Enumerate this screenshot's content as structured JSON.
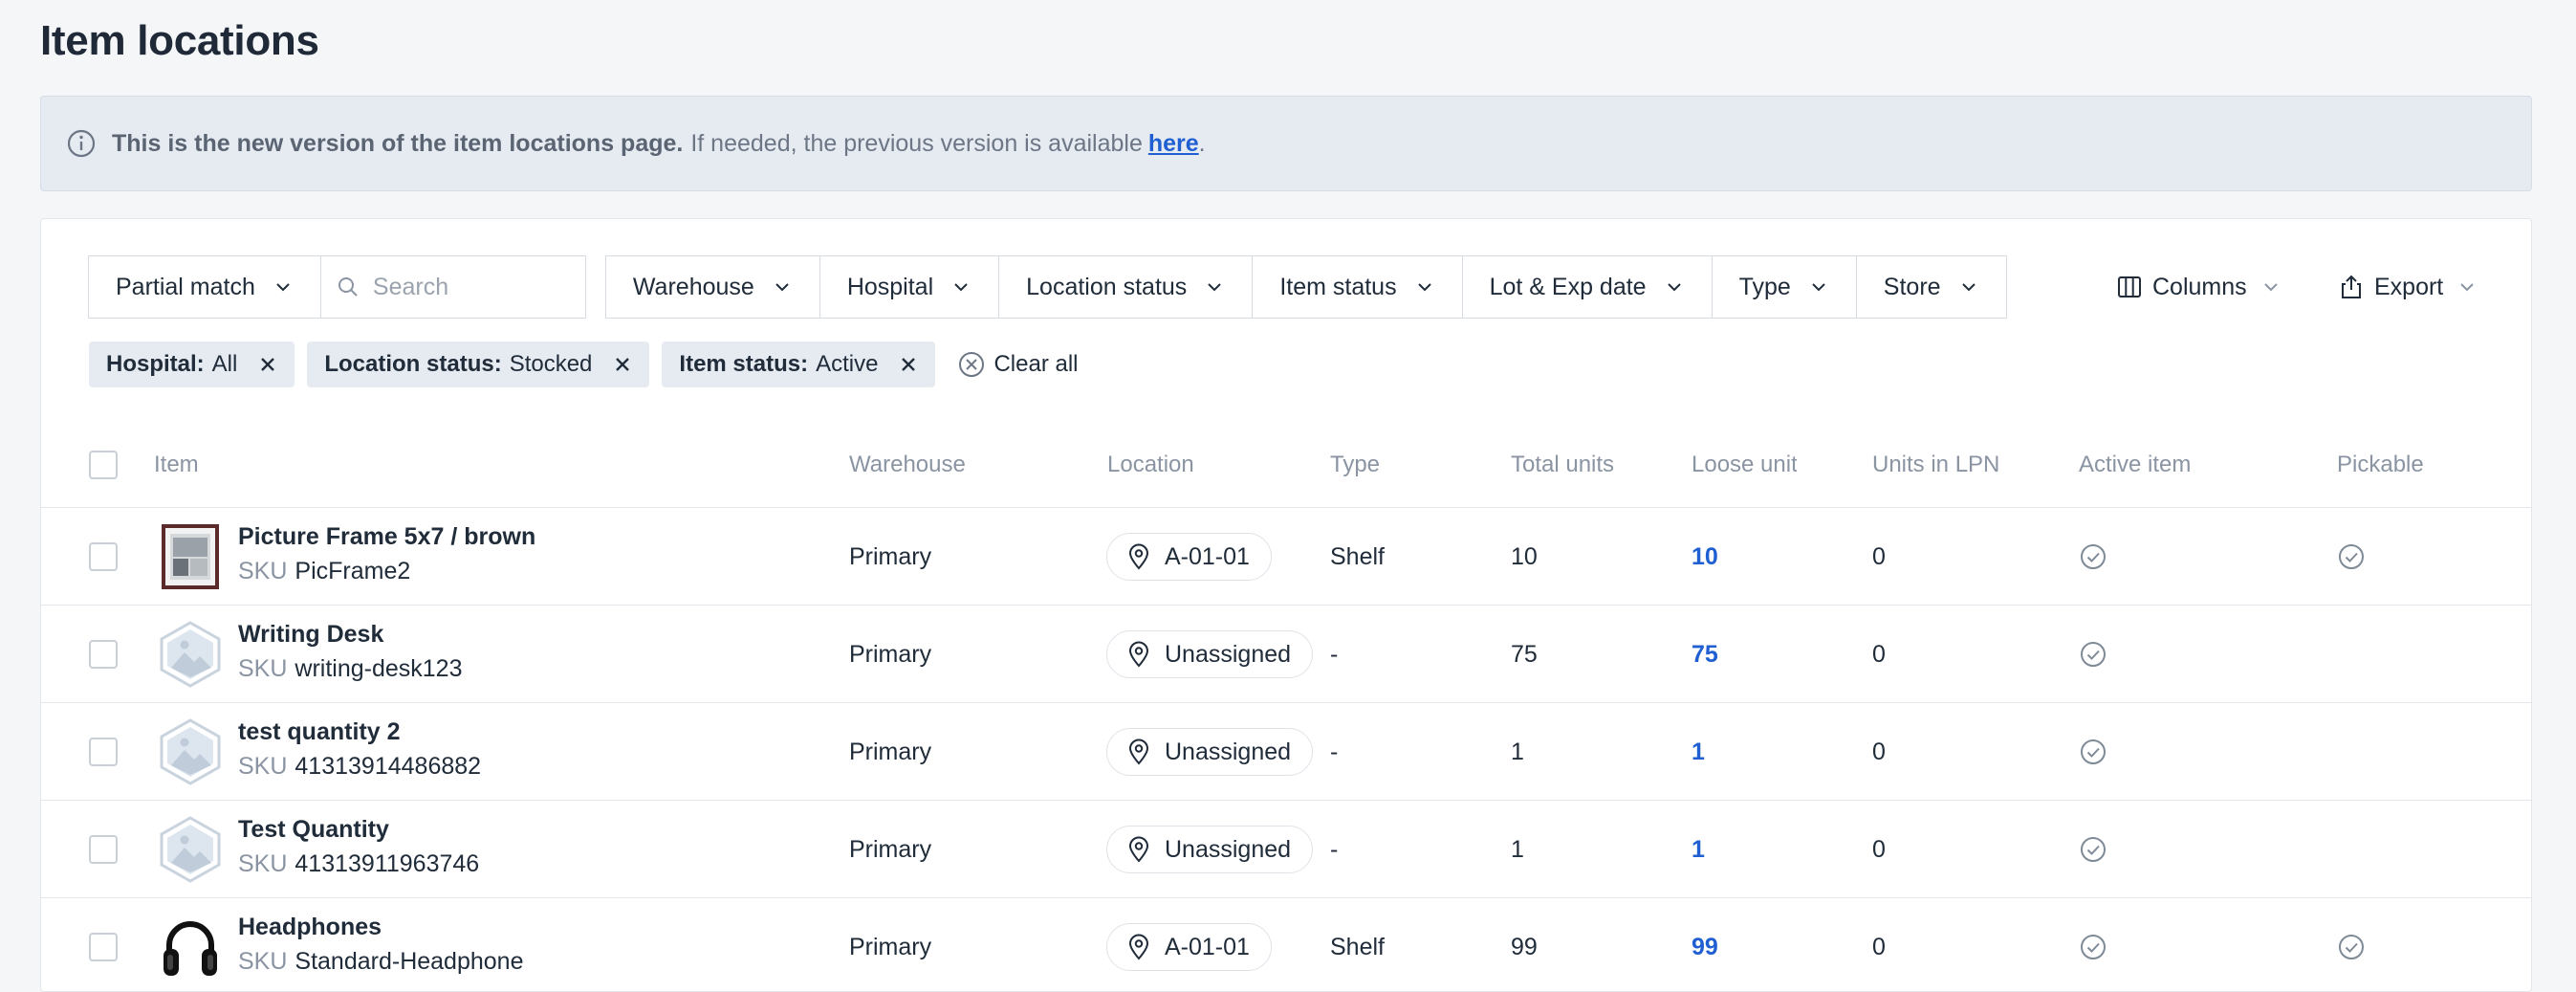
{
  "page": {
    "title": "Item locations"
  },
  "banner": {
    "bold_text": "This is the new version of the item locations page.",
    "text": "If needed, the previous version is available",
    "link": "here",
    "period": "."
  },
  "filters": {
    "match_mode": "Partial match",
    "search_placeholder": "Search",
    "dropdowns": [
      "Warehouse",
      "Hospital",
      "Location status",
      "Item status",
      "Lot & Exp date",
      "Type",
      "Store"
    ],
    "columns_label": "Columns",
    "export_label": "Export"
  },
  "chips": [
    {
      "key": "Hospital:",
      "value": "All"
    },
    {
      "key": "Location status:",
      "value": "Stocked"
    },
    {
      "key": "Item status:",
      "value": "Active"
    }
  ],
  "clear_all": "Clear all",
  "columns": [
    "Item",
    "Warehouse",
    "Location",
    "Type",
    "Total units",
    "Loose units",
    "Units in LPN",
    "Active item",
    "Pickable"
  ],
  "sku_prefix": "SKU",
  "rows": [
    {
      "name": "Picture Frame 5x7 / brown",
      "sku": "PicFrame2",
      "thumb": "picture-frame",
      "warehouse": "Primary",
      "location": "A-01-01",
      "type": "Shelf",
      "total": "10",
      "loose": "10",
      "lpn": "0",
      "active": true,
      "pickable": true
    },
    {
      "name": "Writing Desk",
      "sku": "writing-desk123",
      "thumb": "placeholder",
      "warehouse": "Primary",
      "location": "Unassigned",
      "type": "-",
      "total": "75",
      "loose": "75",
      "lpn": "0",
      "active": true,
      "pickable": false
    },
    {
      "name": "test quantity 2",
      "sku": "41313914486882",
      "thumb": "placeholder",
      "warehouse": "Primary",
      "location": "Unassigned",
      "type": "-",
      "total": "1",
      "loose": "1",
      "lpn": "0",
      "active": true,
      "pickable": false
    },
    {
      "name": "Test Quantity",
      "sku": "41313911963746",
      "thumb": "placeholder",
      "warehouse": "Primary",
      "location": "Unassigned",
      "type": "-",
      "total": "1",
      "loose": "1",
      "lpn": "0",
      "active": true,
      "pickable": false
    },
    {
      "name": "Headphones",
      "sku": "Standard-Headphone",
      "thumb": "headphones",
      "warehouse": "Primary",
      "location": "A-01-01",
      "type": "Shelf",
      "total": "99",
      "loose": "99",
      "lpn": "0",
      "active": true,
      "pickable": true
    }
  ],
  "colors": {
    "link": "#1f5fd1",
    "banner_bg": "#e6ebf2",
    "chip_bg": "#e6ebf2"
  }
}
